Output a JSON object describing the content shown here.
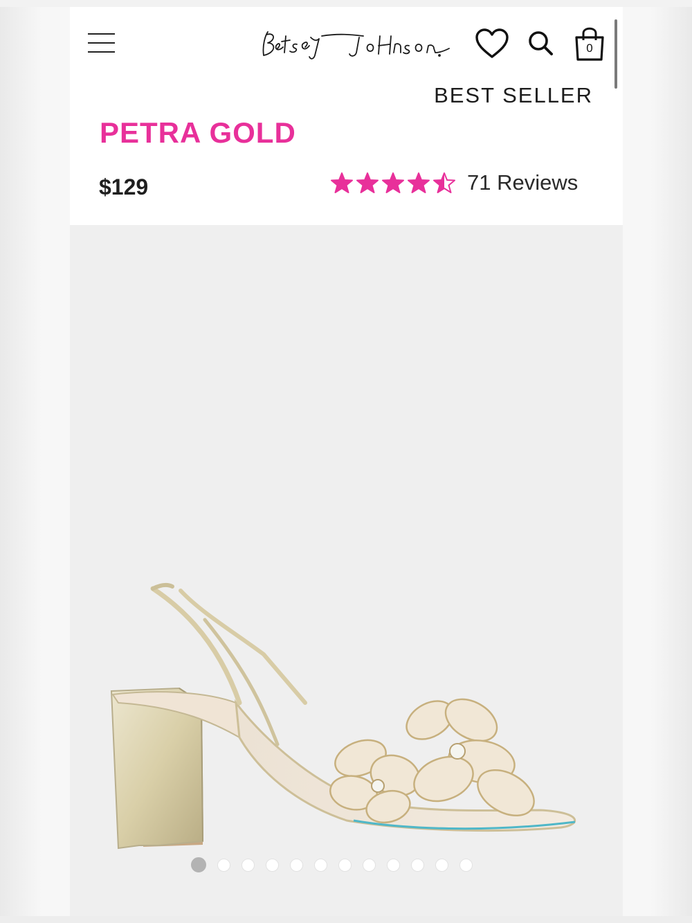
{
  "header": {
    "brand": "Betsey Johnson",
    "cart_count": "0",
    "badge": "BEST SELLER",
    "icons": [
      "menu-icon",
      "heart-icon",
      "search-icon",
      "shopping-bag-icon"
    ]
  },
  "product": {
    "name": "PETRA GOLD",
    "price": "$129",
    "rating": 4.5,
    "rating_max": 5,
    "reviews_label": "71 Reviews"
  },
  "gallery": {
    "image_count": 12,
    "active_index": 0
  },
  "colors": {
    "accent": "#e8309a",
    "text": "#1f1f1f",
    "gallery_bg": "#efefef"
  }
}
